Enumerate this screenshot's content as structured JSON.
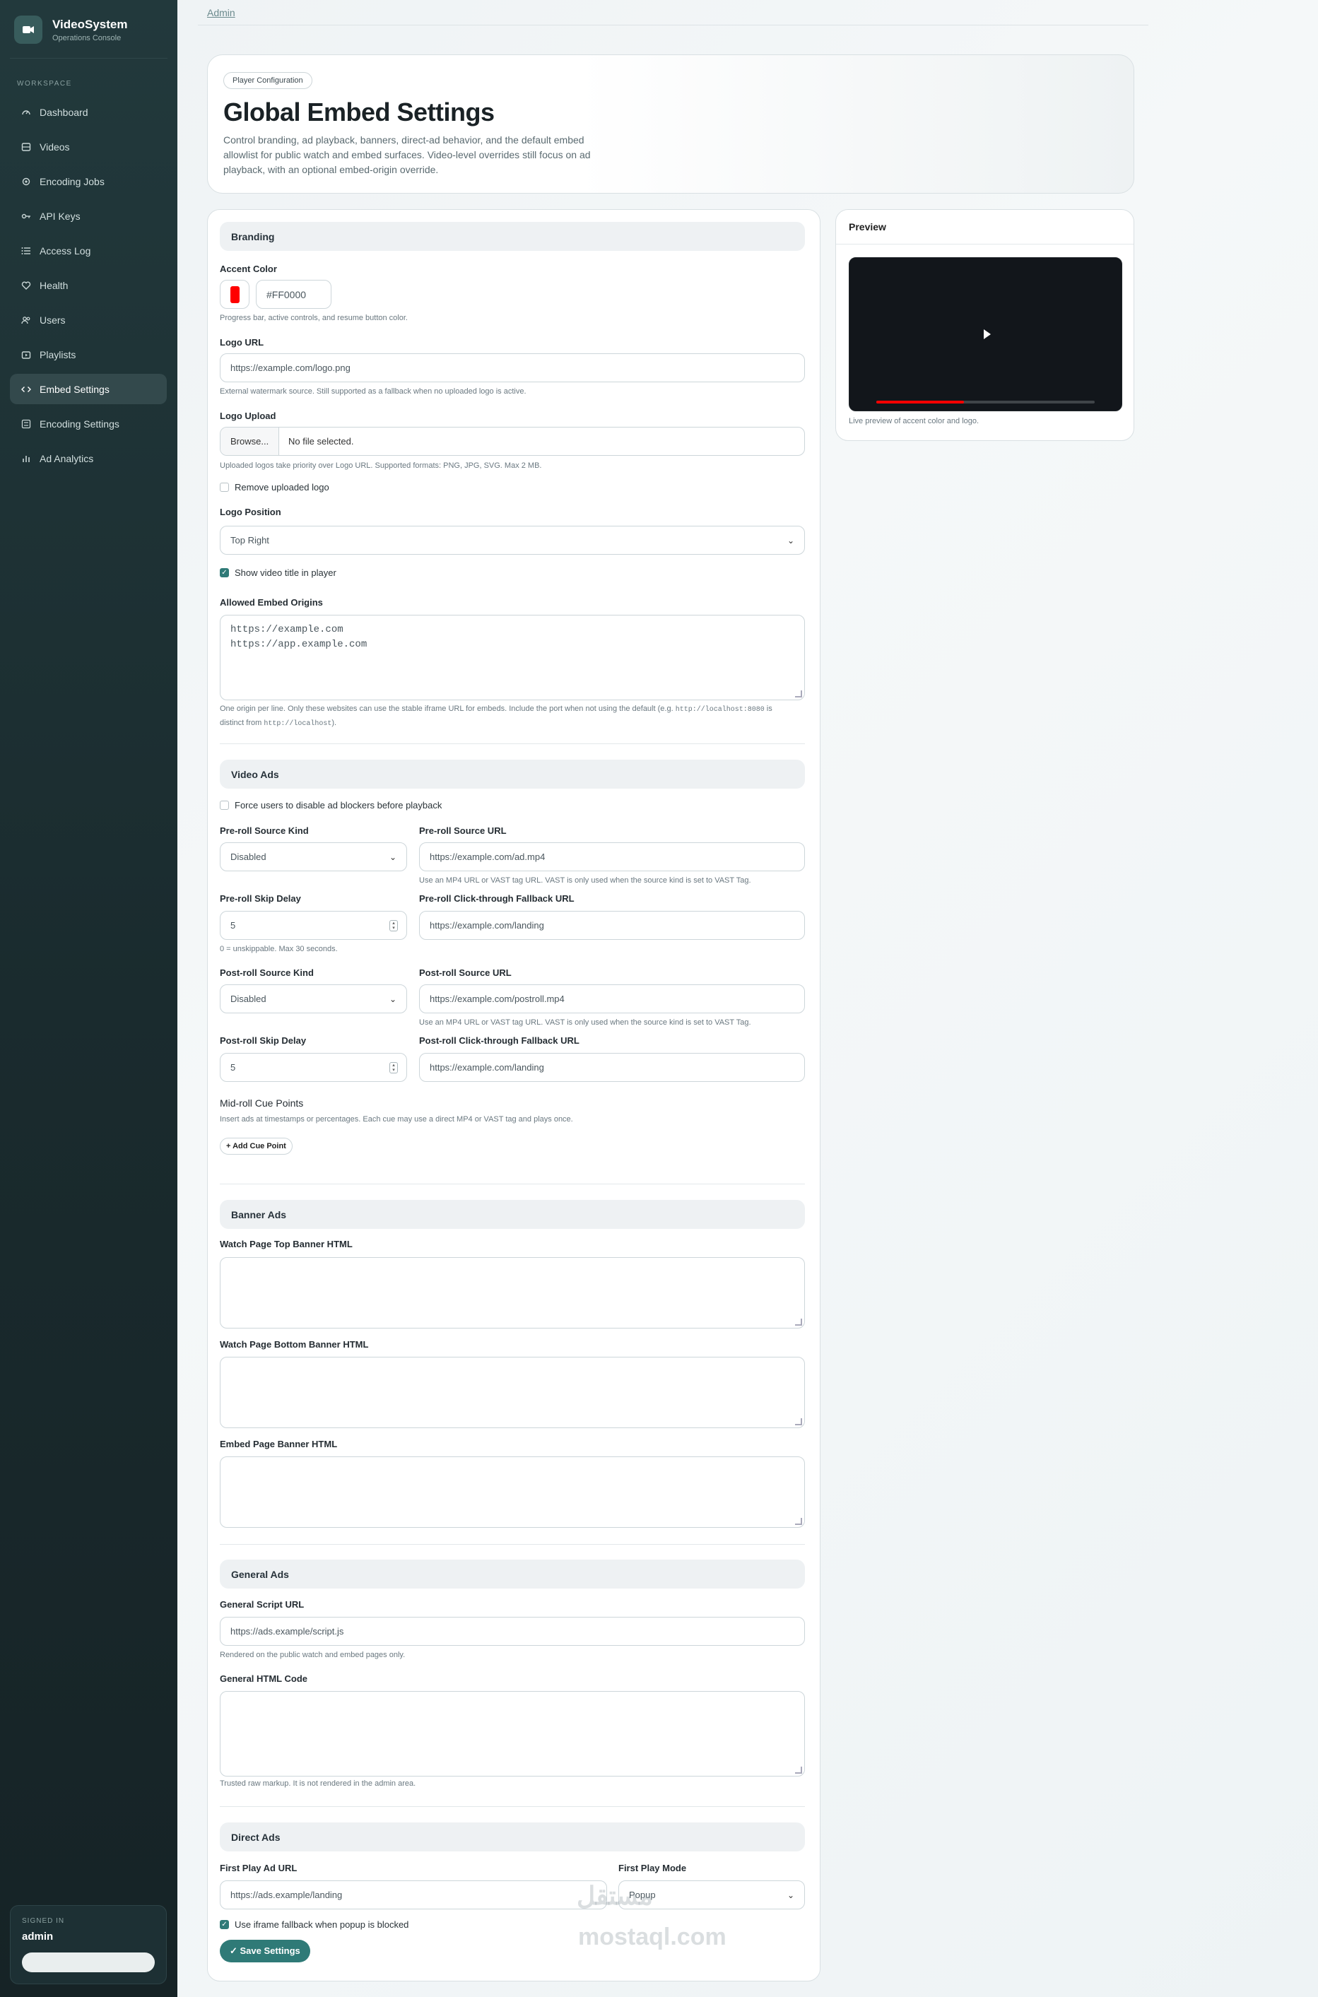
{
  "app": {
    "title": "VideoSystem",
    "subtitle": "Operations Console"
  },
  "sidebar": {
    "section_label": "WORKSPACE",
    "items": [
      {
        "label": "Dashboard",
        "icon": "gauge-icon"
      },
      {
        "label": "Videos",
        "icon": "film-icon"
      },
      {
        "label": "Encoding Jobs",
        "icon": "gear-icon"
      },
      {
        "label": "API Keys",
        "icon": "key-icon"
      },
      {
        "label": "Access Log",
        "icon": "list-icon"
      },
      {
        "label": "Health",
        "icon": "heart-icon"
      },
      {
        "label": "Users",
        "icon": "users-icon"
      },
      {
        "label": "Playlists",
        "icon": "playlist-icon"
      },
      {
        "label": "Embed Settings",
        "icon": "code-icon",
        "active": true
      },
      {
        "label": "Encoding Settings",
        "icon": "sliders-icon"
      },
      {
        "label": "Ad Analytics",
        "icon": "bar-chart-icon"
      }
    ],
    "signed_in_label": "SIGNED IN",
    "user": "admin"
  },
  "breadcrumb": "Admin",
  "hero": {
    "pill": "Player Configuration",
    "title": "Global Embed Settings",
    "description": "Control branding, ad playback, banners, direct-ad behavior, and the default embed allowlist for public watch and embed surfaces. Video-level overrides still focus on ad playback, with an optional embed-origin override."
  },
  "branding": {
    "heading": "Branding",
    "accent_label": "Accent Color",
    "accent_value": "#FF0000",
    "accent_help": "Progress bar, active controls, and resume button color.",
    "logo_url_label": "Logo URL",
    "logo_url_placeholder": "https://example.com/logo.png",
    "logo_url_help": "External watermark source. Still supported as a fallback when no uploaded logo is active.",
    "logo_upload_label": "Logo Upload",
    "browse_label": "Browse...",
    "no_file": "No file selected.",
    "logo_upload_help": "Uploaded logos take priority over Logo URL. Supported formats: PNG, JPG, SVG. Max 2 MB.",
    "remove_logo": "Remove uploaded logo",
    "logo_position_label": "Logo Position",
    "logo_position_value": "Top Right",
    "show_title": "Show video title in player",
    "origins_label": "Allowed Embed Origins",
    "origins_value": "https://example.com\nhttps://app.example.com",
    "origins_help_1": "One origin per line. Only these websites can use the stable iframe URL for embeds. Include the port when not using the default (e.g. ",
    "origins_help_code1": "http://localhost:8080",
    "origins_help_2": " is distinct from ",
    "origins_help_code2": "http://localhost",
    "origins_help_3": ")."
  },
  "video_ads": {
    "heading": "Video Ads",
    "force_adblock": "Force users to disable ad blockers before playback",
    "preroll_kind_label": "Pre-roll Source Kind",
    "preroll_kind_value": "Disabled",
    "preroll_url_label": "Pre-roll Source URL",
    "preroll_url_placeholder": "https://example.com/ad.mp4",
    "preroll_url_help": "Use an MP4 URL or VAST tag URL. VAST is only used when the source kind is set to VAST Tag.",
    "preroll_skip_label": "Pre-roll Skip Delay",
    "preroll_skip_value": "5",
    "preroll_skip_help": "0 = unskippable. Max 30 seconds.",
    "preroll_click_label": "Pre-roll Click-through Fallback URL",
    "preroll_click_placeholder": "https://example.com/landing",
    "postroll_kind_label": "Post-roll Source Kind",
    "postroll_kind_value": "Disabled",
    "postroll_url_label": "Post-roll Source URL",
    "postroll_url_placeholder": "https://example.com/postroll.mp4",
    "postroll_url_help": "Use an MP4 URL or VAST tag URL. VAST is only used when the source kind is set to VAST Tag.",
    "postroll_skip_label": "Post-roll Skip Delay",
    "postroll_skip_value": "5",
    "postroll_click_label": "Post-roll Click-through Fallback URL",
    "postroll_click_placeholder": "https://example.com/landing",
    "midroll_label": "Mid-roll Cue Points",
    "midroll_help": "Insert ads at timestamps or percentages. Each cue may use a direct MP4 or VAST tag and plays once.",
    "add_cue": "+ Add Cue Point"
  },
  "banner_ads": {
    "heading": "Banner Ads",
    "top_label": "Watch Page Top Banner HTML",
    "bottom_label": "Watch Page Bottom Banner HTML",
    "embed_label": "Embed Page Banner HTML"
  },
  "general_ads": {
    "heading": "General Ads",
    "script_label": "General Script URL",
    "script_placeholder": "https://ads.example/script.js",
    "script_help": "Rendered on the public watch and embed pages only.",
    "html_label": "General HTML Code",
    "html_help": "Trusted raw markup. It is not rendered in the admin area."
  },
  "direct_ads": {
    "heading": "Direct Ads",
    "first_url_label": "First Play Ad URL",
    "first_url_placeholder": "https://ads.example/landing",
    "first_mode_label": "First Play Mode",
    "first_mode_value": "Popup",
    "iframe_fallback": "Use iframe fallback when popup is blocked",
    "save": "✓ Save Settings"
  },
  "preview": {
    "title": "Preview",
    "help": "Live preview of accent color and logo.",
    "progress_fraction": 0.4
  },
  "colors": {
    "accent": "#FF0000",
    "primary": "#2f7a77",
    "sidebar": "#1a2b2e"
  },
  "watermark": {
    "arabic": "مستقل",
    "latin": "mostaql.com"
  }
}
